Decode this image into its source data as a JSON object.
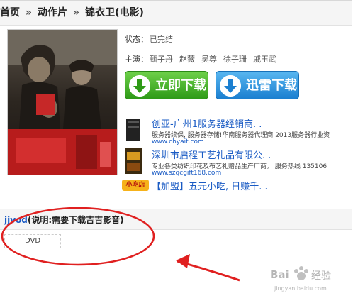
{
  "breadcrumb": {
    "home": "首页",
    "sep": "»",
    "category": "动作片",
    "title": "锦衣卫(电影)"
  },
  "info": {
    "status_label": "状态：",
    "status_value": "已完结",
    "cast_label": "主演：",
    "cast": [
      "甄子丹",
      "赵薇",
      "吴尊",
      "徐子珊",
      "戚玉武"
    ]
  },
  "buttons": {
    "instant": "立即下载",
    "thunder": "迅雷下载"
  },
  "ads": [
    {
      "title": "创亚-广州1服务器经销商. .",
      "desc": "服务器续保, 服务器存储!华南服务器代理商  2013服务器行业资",
      "url": "www.chyait.com"
    },
    {
      "title": "深圳市启程工艺礼品有限公. .",
      "desc": "专业各类纺织印花及布艺礼赠品生产厂商。  服务热线  135106",
      "url": "www.szqcgift168.com"
    },
    {
      "title": "【加盟】五元小吃, 日赚千. .",
      "badge": "小吃店"
    }
  ],
  "player": {
    "name": "jjvod",
    "note": "(说明:需要下载吉吉影音)",
    "quality": "DVD"
  },
  "watermark": {
    "brand": "Bai",
    "sub": "jingyan.baidu.com",
    "logo_text": "经验"
  },
  "colors": {
    "link": "#1a5bc4",
    "green_btn": "#3aa820",
    "blue_btn": "#2d8be0",
    "annotation_red": "#e02020"
  }
}
